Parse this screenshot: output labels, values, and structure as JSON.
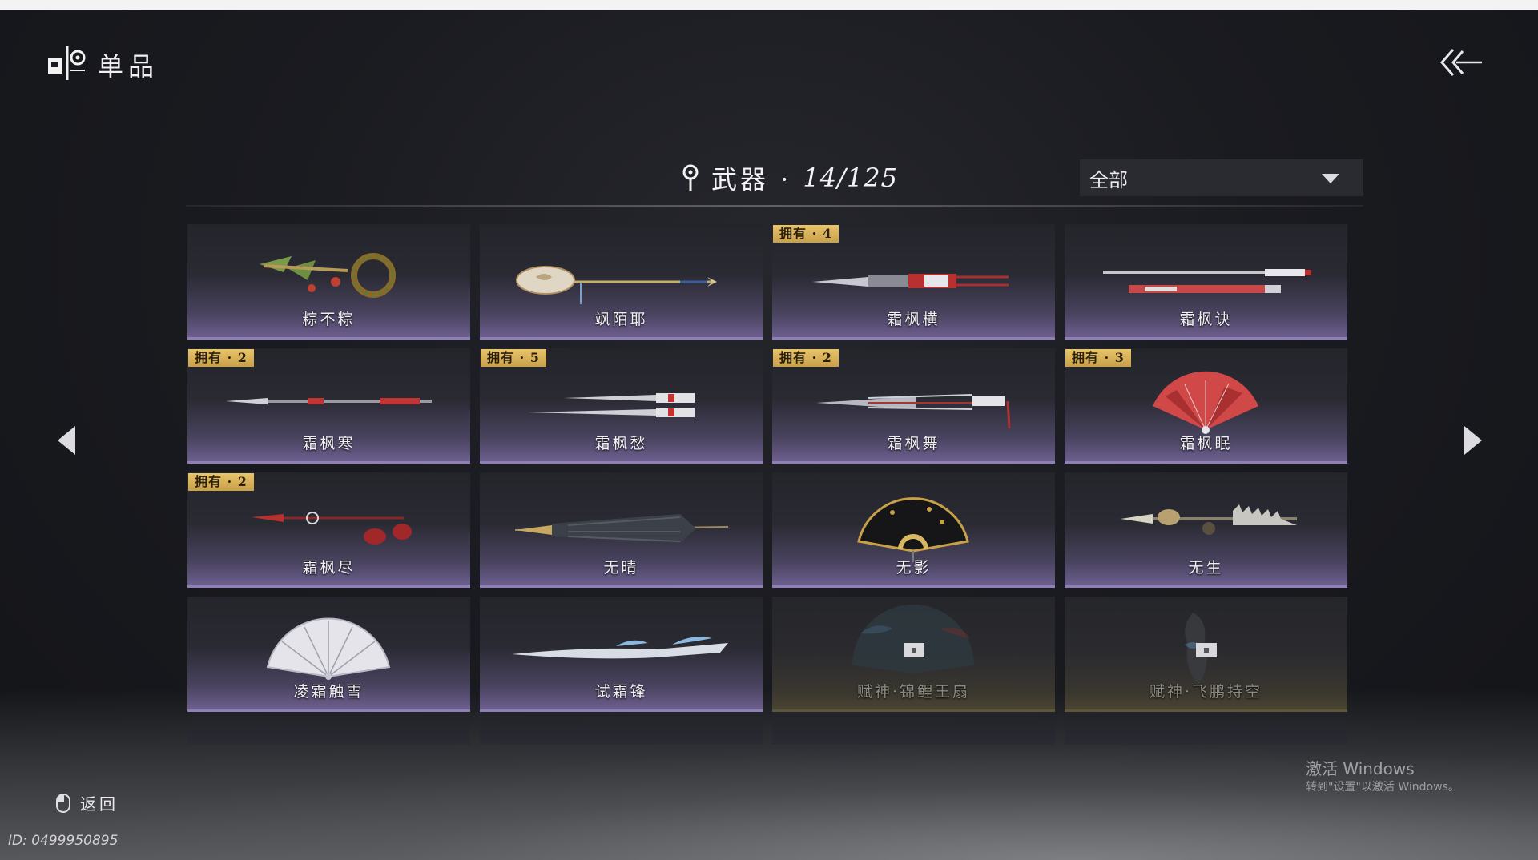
{
  "header": {
    "title": "单品"
  },
  "category": {
    "label": "武器 · ",
    "count": "14/125"
  },
  "filter": {
    "selected": "全部"
  },
  "items": [
    {
      "name": "粽不粽",
      "badge": "",
      "locked": false
    },
    {
      "name": "飒陌耶",
      "badge": "",
      "locked": false
    },
    {
      "name": "霜枫横",
      "badge": "拥有 · 4",
      "locked": false
    },
    {
      "name": "霜枫诀",
      "badge": "",
      "locked": false
    },
    {
      "name": "霜枫寒",
      "badge": "拥有 · 2",
      "locked": false
    },
    {
      "name": "霜枫愁",
      "badge": "拥有 · 5",
      "locked": false
    },
    {
      "name": "霜枫舞",
      "badge": "拥有 · 2",
      "locked": false
    },
    {
      "name": "霜枫眠",
      "badge": "拥有 · 3",
      "locked": false
    },
    {
      "name": "霜枫尽",
      "badge": "拥有 · 2",
      "locked": false
    },
    {
      "name": "无晴",
      "badge": "",
      "locked": false
    },
    {
      "name": "无影",
      "badge": "",
      "locked": false
    },
    {
      "name": "无生",
      "badge": "",
      "locked": false
    },
    {
      "name": "凌霜触雪",
      "badge": "",
      "locked": false
    },
    {
      "name": "试霜锋",
      "badge": "",
      "locked": false
    },
    {
      "name": "赋神·锦鲤王扇",
      "badge": "",
      "locked": true
    },
    {
      "name": "赋神·飞鹏持空",
      "badge": "",
      "locked": true
    }
  ],
  "footer": {
    "back_label": "返回",
    "player_id": "ID: 0499950895"
  },
  "watermark": {
    "title": "激活 Windows",
    "subtitle": "转到\"设置\"以激活 Windows。"
  },
  "icons": {
    "logo": "app-logo-icon",
    "back": "double-chevron-back-icon",
    "pin": "location-pin-icon",
    "dropdown": "chevron-down-icon",
    "prev": "triangle-left-icon",
    "next": "triangle-right-icon",
    "mouse": "mouse-icon",
    "lock": "lock-icon"
  },
  "colors": {
    "badge": "#e0bb62",
    "card_accent": "#8f7fb8",
    "background": "#1a1b20"
  }
}
